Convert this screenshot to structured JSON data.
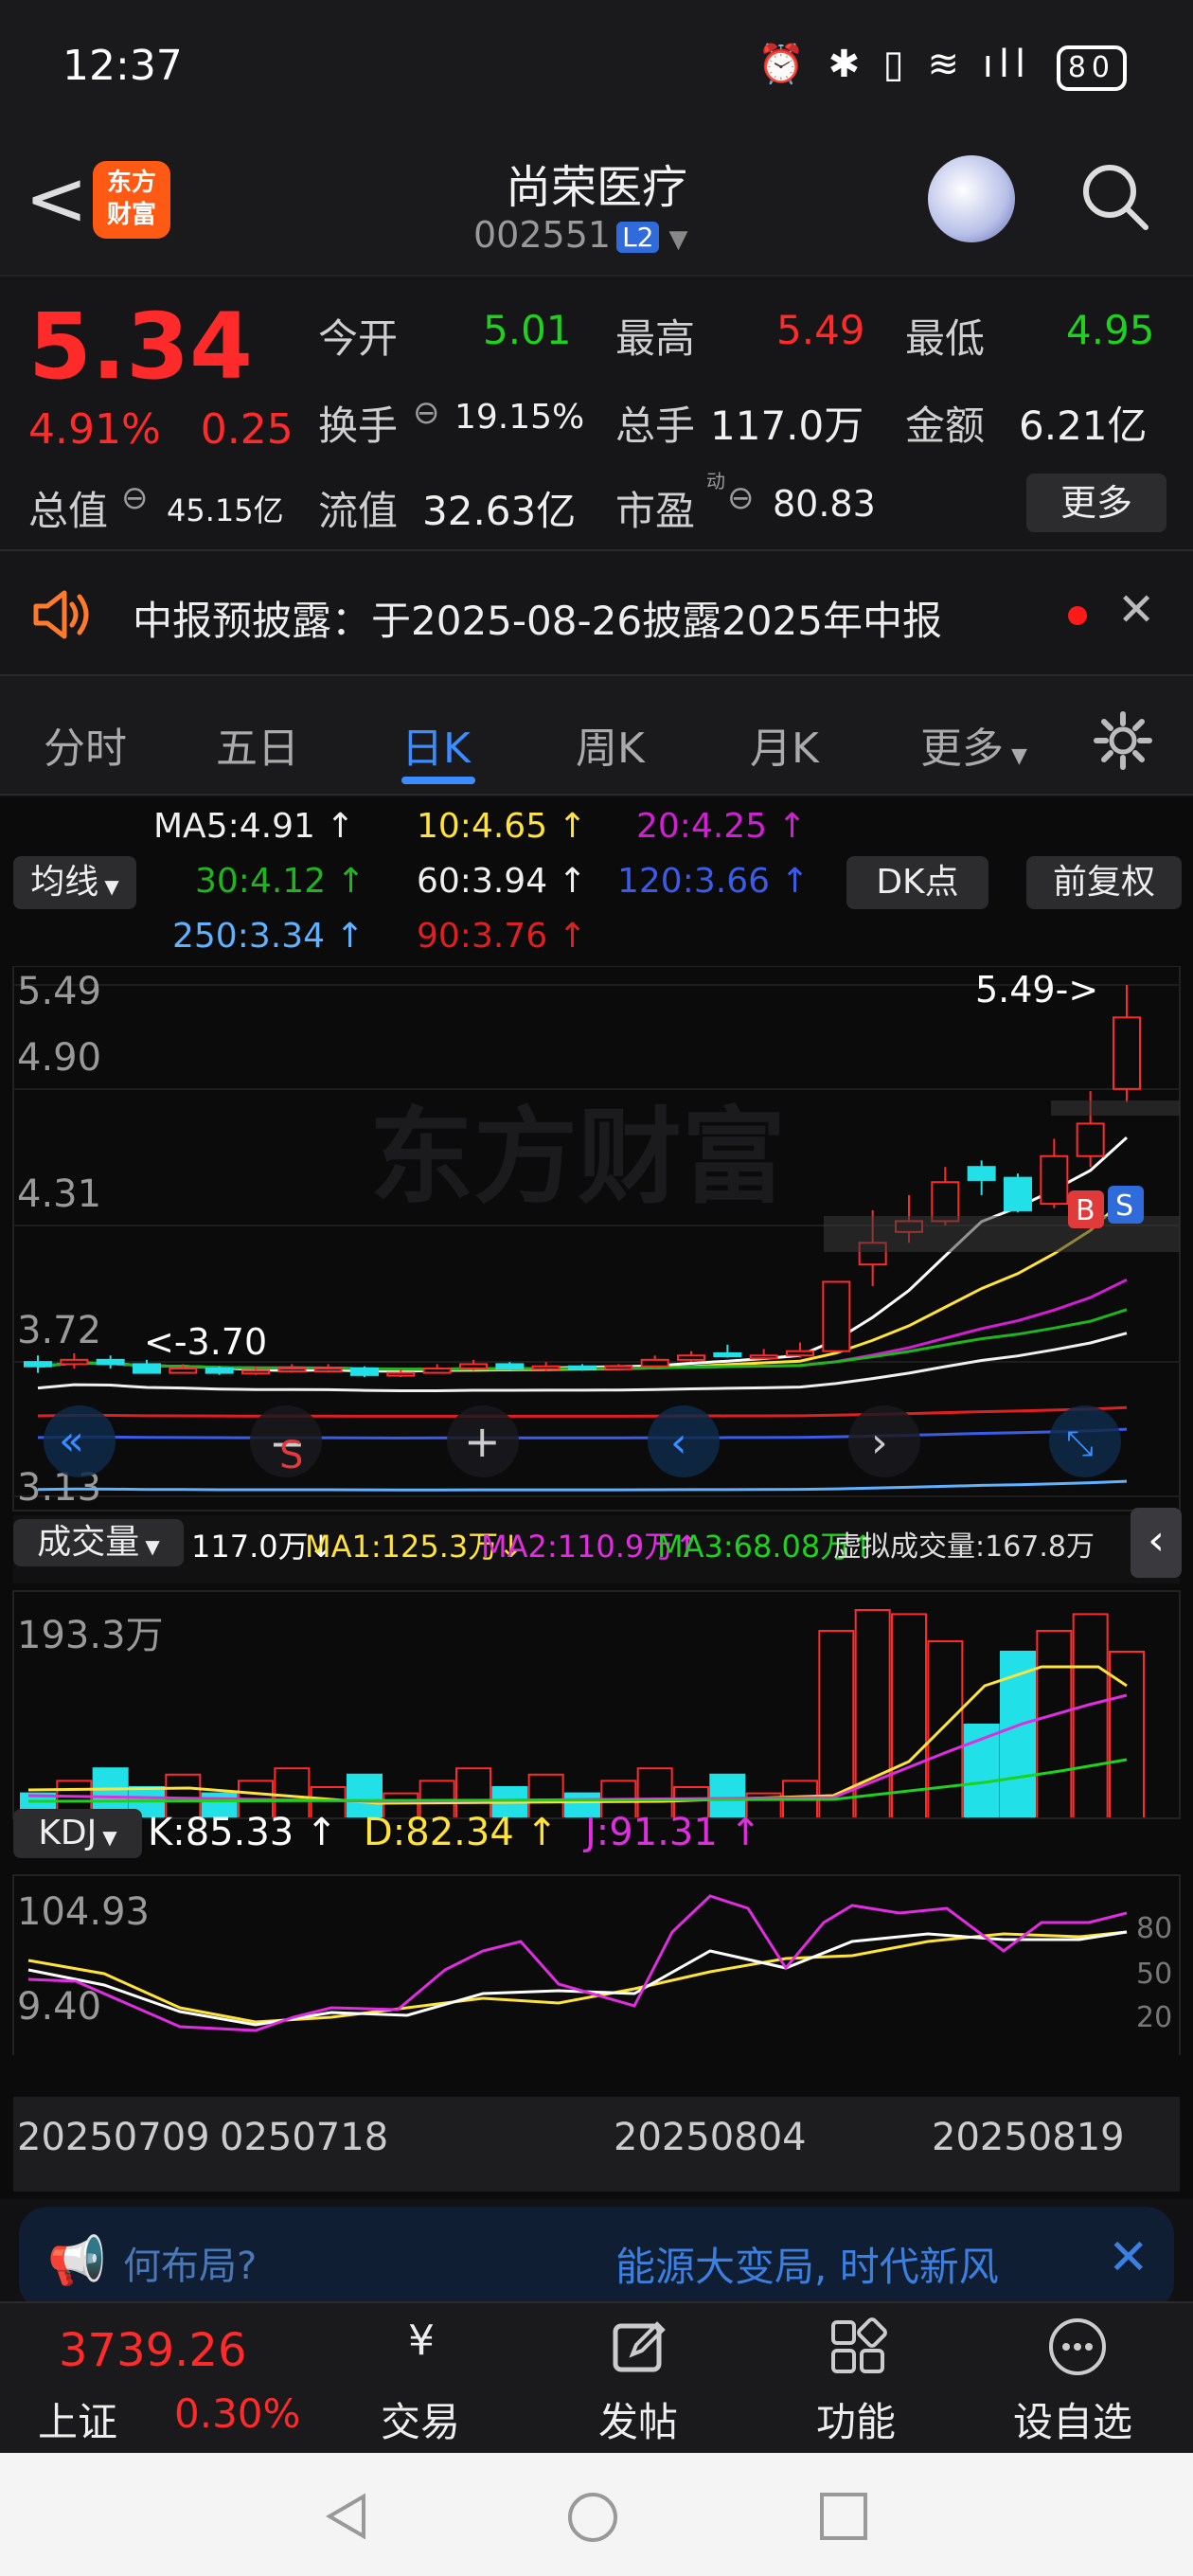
{
  "status": {
    "time": "12:37",
    "battery": "80",
    "icons": "⏰ ✱ ▯ ≋ ıll"
  },
  "header": {
    "back": "<",
    "logo": "东方\n财富",
    "title": "尚荣医疗",
    "code": "002551",
    "level": "L2"
  },
  "quote": {
    "price": "5.34",
    "pct": "4.91%",
    "chg": "0.25",
    "open_label": "今开",
    "open": "5.01",
    "high_label": "最高",
    "high": "5.49",
    "low_label": "最低",
    "low": "4.95",
    "turnover_label": "换手",
    "turnover": "19.15%",
    "volume_label": "总手",
    "volume": "117.0万",
    "amount_label": "金额",
    "amount": "6.21亿",
    "mktcap_label": "总值",
    "mktcap": "45.15亿",
    "float_label": "流值",
    "float": "32.63亿",
    "pe_label": "市盈",
    "pe_sup": "动",
    "pe": "80.83",
    "more": "更多"
  },
  "notice": {
    "text": "中报预披露：于2025-08-26披露2025年中报"
  },
  "tabs": [
    "分时",
    "五日",
    "日K",
    "周K",
    "月K",
    "更多"
  ],
  "ma": {
    "ma5": "MA5:4.91",
    "ma10": "10:4.65",
    "ma20": "20:4.25",
    "ma30": "30:4.12",
    "ma60": "60:3.94",
    "ma120": "120:3.66",
    "ma250": "250:3.34",
    "ma90": "90:3.76",
    "select": "均线",
    "dk": "DK点",
    "fq": "前复权"
  },
  "chart_data": {
    "type": "candlestick",
    "y_ticks": [
      "5.49",
      "4.90",
      "4.31",
      "3.72",
      "3.13"
    ],
    "ylim": [
      3.13,
      5.49
    ],
    "high_mark": "5.49->",
    "low_mark": "<-3.70",
    "x_labels": [
      "20250709",
      "0250718",
      "20250804",
      "20250819"
    ],
    "candles": [
      [
        3.75,
        3.73,
        3.78,
        3.7
      ],
      [
        3.74,
        3.76,
        3.79,
        3.72
      ],
      [
        3.76,
        3.74,
        3.78,
        3.72
      ],
      [
        3.74,
        3.7,
        3.76,
        3.7
      ],
      [
        3.7,
        3.72,
        3.74,
        3.7
      ],
      [
        3.72,
        3.7,
        3.73,
        3.69
      ],
      [
        3.7,
        3.71,
        3.73,
        3.69
      ],
      [
        3.71,
        3.72,
        3.74,
        3.7
      ],
      [
        3.72,
        3.72,
        3.74,
        3.7
      ],
      [
        3.72,
        3.69,
        3.73,
        3.68
      ],
      [
        3.69,
        3.7,
        3.72,
        3.68
      ],
      [
        3.7,
        3.72,
        3.74,
        3.7
      ],
      [
        3.72,
        3.74,
        3.76,
        3.71
      ],
      [
        3.74,
        3.72,
        3.75,
        3.71
      ],
      [
        3.72,
        3.73,
        3.75,
        3.71
      ],
      [
        3.73,
        3.72,
        3.74,
        3.71
      ],
      [
        3.72,
        3.73,
        3.74,
        3.71
      ],
      [
        3.73,
        3.76,
        3.78,
        3.72
      ],
      [
        3.76,
        3.78,
        3.8,
        3.75
      ],
      [
        3.79,
        3.78,
        3.83,
        3.77
      ],
      [
        3.78,
        3.78,
        3.81,
        3.77
      ],
      [
        3.78,
        3.8,
        3.84,
        3.77
      ],
      [
        3.8,
        4.12,
        4.12,
        3.8
      ],
      [
        4.2,
        4.3,
        4.45,
        4.1
      ],
      [
        4.35,
        4.4,
        4.52,
        4.3
      ],
      [
        4.4,
        4.58,
        4.65,
        4.38
      ],
      [
        4.65,
        4.59,
        4.68,
        4.52
      ],
      [
        4.6,
        4.45,
        4.62,
        4.44
      ],
      [
        4.48,
        4.7,
        4.78,
        4.46
      ],
      [
        4.7,
        4.85,
        5.0,
        4.65
      ],
      [
        5.01,
        5.34,
        5.49,
        4.95
      ]
    ],
    "volume": {
      "label": "成交量",
      "vol": "117.0万",
      "ma1": "MA1:125.3万",
      "ma2": "MA2:110.9万",
      "ma3": "MA3:68.08万",
      "virtual": "虚拟成交量:167.8万",
      "max_tick": "193.3万"
    },
    "kdj": {
      "label": "KDJ",
      "k": "K:85.33",
      "d": "D:82.34",
      "j": "J:91.31",
      "top": "104.93",
      "bottom": "9.40",
      "levels": [
        "80",
        "50",
        "20"
      ]
    }
  },
  "ad": {
    "left": "何布局?",
    "right": "能源大变局, 时代新风"
  },
  "index": {
    "value": "3739.26",
    "name": "上证",
    "pct": "0.30%"
  },
  "nav": [
    "交易",
    "发帖",
    "功能",
    "设自选"
  ]
}
